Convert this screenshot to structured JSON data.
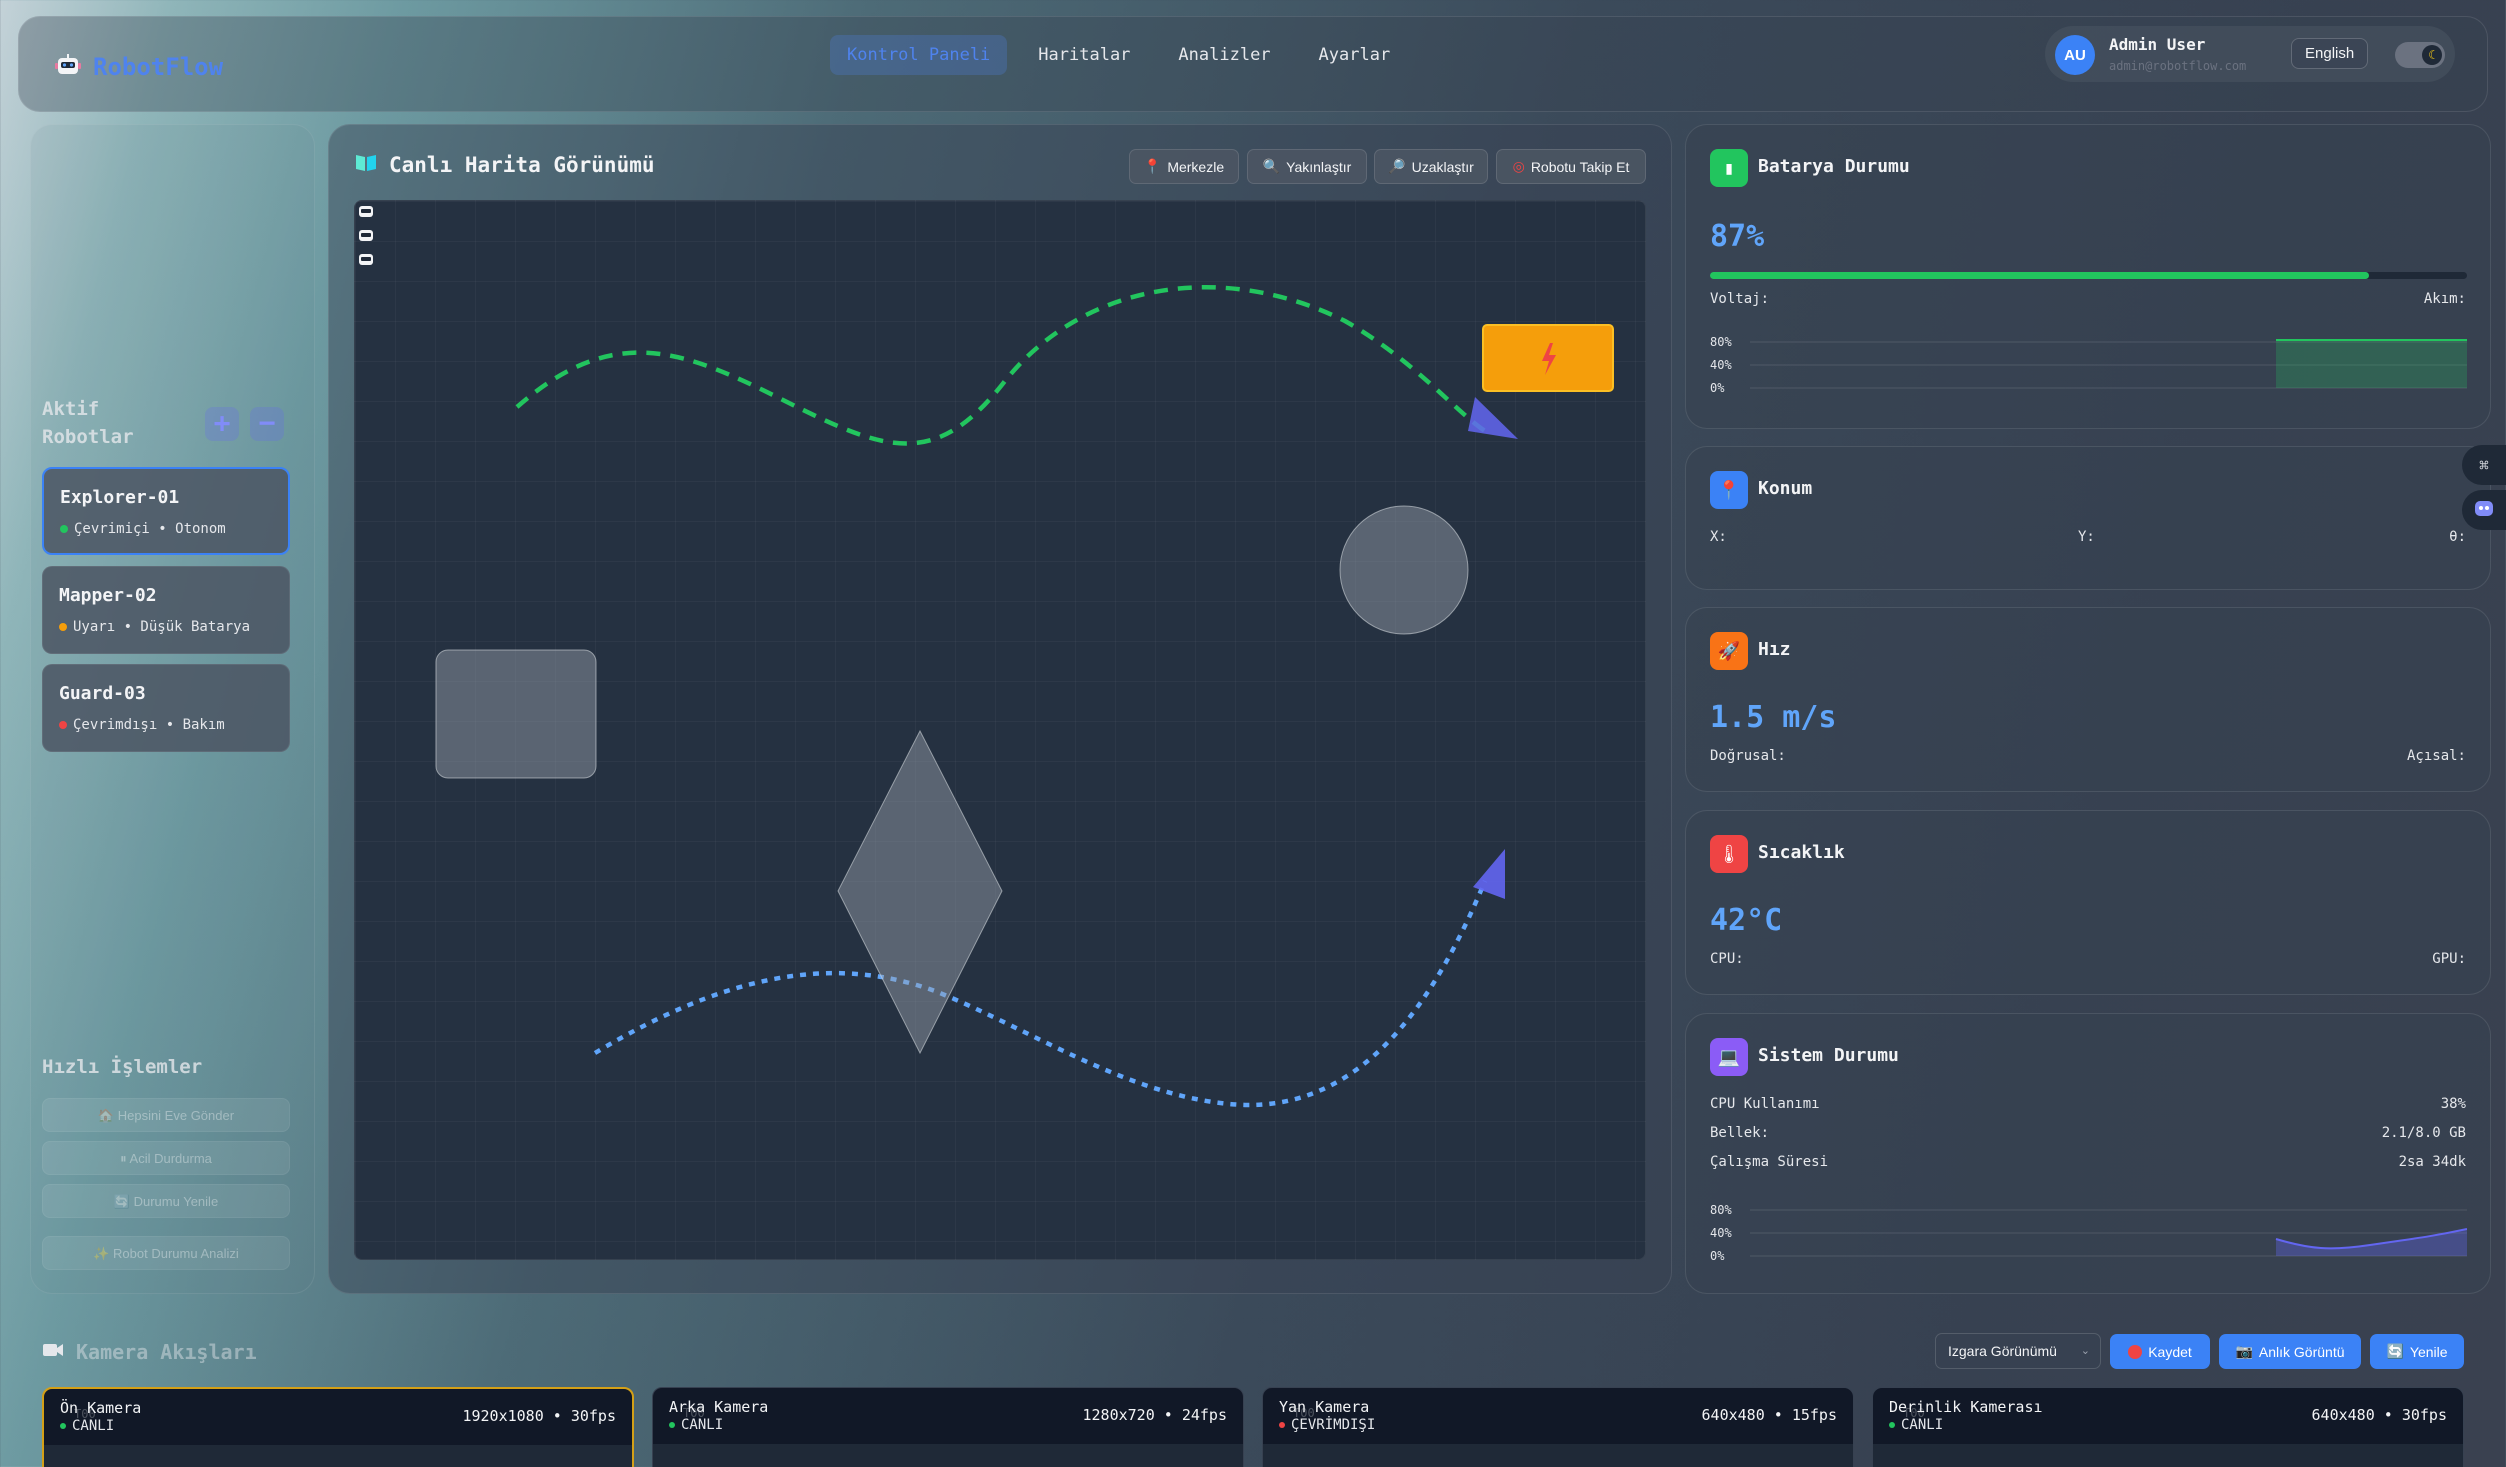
{
  "header": {
    "brand": "RobotFlow",
    "nav": [
      "Kontrol Paneli",
      "Haritalar",
      "Analizler",
      "Ayarlar"
    ],
    "user": {
      "initials": "AU",
      "name": "Admin User",
      "email": "admin@robotflow.com"
    },
    "language": "English"
  },
  "sidebar": {
    "robots_title": "Aktif Robotlar",
    "robots": [
      {
        "name": "Explorer-01",
        "status": "Çevrimiçi • Otonom",
        "status_color": "#22c55e"
      },
      {
        "name": "Mapper-02",
        "status": "Uyarı • Düşük Batarya",
        "status_color": "#f59e0b"
      },
      {
        "name": "Guard-03",
        "status": "Çevrimdışı • Bakım",
        "status_color": "#ef4444"
      }
    ],
    "quick_title": "Hızlı İşlemler",
    "quick_actions": [
      "🏠 Hepsini Eve Gönder",
      "⏸ Acil Durdurma",
      "🔄 Durumu Yenile",
      "✨ Robot Durumu Analizi"
    ]
  },
  "map": {
    "title": "Canlı Harita Görünümü",
    "buttons": [
      "Merkezle",
      "Yakınlaştır",
      "Uzaklaştır",
      "Robotu Takip Et"
    ]
  },
  "battery": {
    "title": "Batarya Durumu",
    "value": "87%",
    "level": 0.87,
    "voltage_label": "Voltaj:",
    "current_label": "Akım:",
    "chart_ticks": [
      "80%",
      "40%",
      "0%"
    ]
  },
  "location": {
    "title": "Konum",
    "x_label": "X:",
    "y_label": "Y:",
    "theta_label": "θ:"
  },
  "speed": {
    "title": "Hız",
    "value": "1.5 m/s",
    "linear_label": "Doğrusal:",
    "angular_label": "Açısal:"
  },
  "temperature": {
    "title": "Sıcaklık",
    "value": "42°C",
    "cpu_label": "CPU:",
    "gpu_label": "GPU:"
  },
  "system": {
    "title": "Sistem Durumu",
    "rows": [
      {
        "label": "CPU Kullanımı",
        "value": "38%"
      },
      {
        "label": "Bellek:",
        "value": "2.1/8.0 GB"
      },
      {
        "label": "Çalışma Süresi",
        "value": "2sa 34dk"
      }
    ],
    "chart_ticks": [
      "80%",
      "40%",
      "0%"
    ]
  },
  "cameras": {
    "title": "Kamera Akışları",
    "view_select": "Izgara Görünümü",
    "buttons": [
      "Kaydet",
      "Anlık Görüntü",
      "Yenile"
    ],
    "feeds": [
      {
        "name": "Ön Kamera",
        "status": "CANLI",
        "resolution": "1920x1080 • 30fps",
        "status_color": "#22c55e",
        "ghost": "T00"
      },
      {
        "name": "Arka Kamera",
        "status": "CANLI",
        "resolution": "1280x720 • 24fps",
        "status_color": "#22c55e",
        "ghost": "T00"
      },
      {
        "name": "Yan Kamera",
        "status": "ÇEVRİMDIŞI",
        "resolution": "640x480 • 15fps",
        "status_color": "#ef4444",
        "ghost": "T00"
      },
      {
        "name": "Derinlik Kamerası",
        "status": "CANLI",
        "resolution": "640x480 • 30fps",
        "status_color": "#22c55e",
        "ghost": "T00"
      }
    ]
  }
}
